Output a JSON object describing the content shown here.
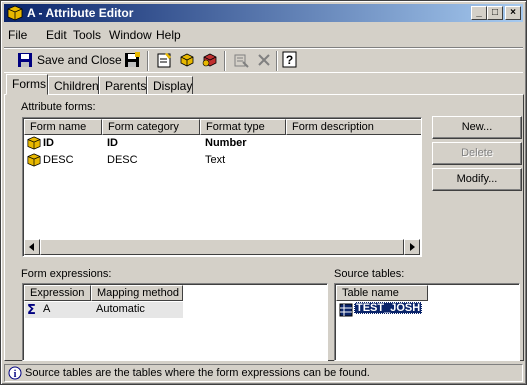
{
  "window": {
    "title": "A - Attribute Editor",
    "controls": {
      "minimize": "_",
      "restore": "□",
      "close": "×"
    }
  },
  "menu": [
    "File",
    "Edit",
    "Tools",
    "Window",
    "Help"
  ],
  "toolbar": {
    "save_close_label": "Save and Close"
  },
  "tabs": [
    "Forms",
    "Children",
    "Parents",
    "Display"
  ],
  "attribute_forms": {
    "label": "Attribute forms:",
    "columns": [
      "Form name",
      "Form category",
      "Format type",
      "Form description"
    ],
    "rows": [
      {
        "name": "ID",
        "category": "ID",
        "format": "Number",
        "description": ""
      },
      {
        "name": "DESC",
        "category": "DESC",
        "format": "Text",
        "description": ""
      }
    ]
  },
  "buttons": {
    "new": "New...",
    "delete": "Delete",
    "modify": "Modify..."
  },
  "form_expressions": {
    "label": "Form expressions:",
    "columns": [
      "Expression",
      "Mapping method"
    ],
    "rows": [
      {
        "expression": "A",
        "mapping": "Automatic"
      }
    ]
  },
  "source_tables": {
    "label": "Source tables:",
    "columns": [
      "Table name"
    ],
    "rows": [
      "TEST_JOSH"
    ]
  },
  "status": {
    "text": "Source tables are the tables where the form expressions can be found."
  },
  "icons": [
    "app-cube-icon",
    "save-icon",
    "new-attribute-icon",
    "cube-icon",
    "cube-red-icon",
    "properties-icon",
    "delete-x-icon",
    "help-icon",
    "sigma-icon",
    "table-icon",
    "info-icon"
  ]
}
